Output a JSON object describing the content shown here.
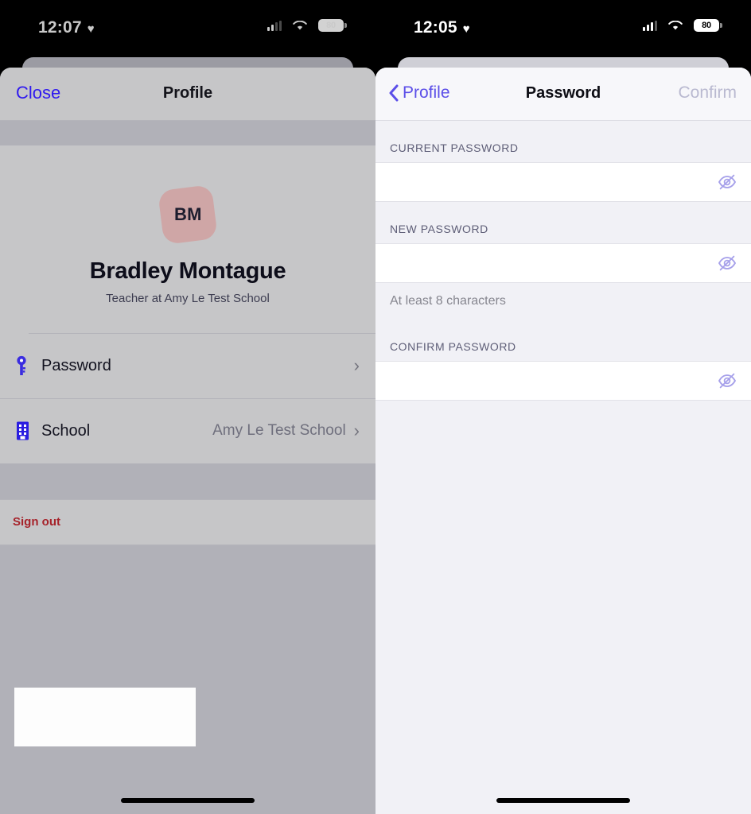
{
  "left": {
    "status": {
      "time": "12:07",
      "heart": "♥",
      "battery": "80",
      "signal_bars": 2,
      "signal_total": 4
    },
    "navbar": {
      "close_label": "Close",
      "title": "Profile"
    },
    "profile": {
      "avatar_initials": "BM",
      "avatar_color": "#cfa6a6",
      "name": "Bradley Montague",
      "role": "Teacher at Amy Le Test School"
    },
    "rows": [
      {
        "icon": "key-icon",
        "label": "Password",
        "value": "",
        "chevron": "›",
        "selected": true
      },
      {
        "icon": "building-icon",
        "label": "School",
        "value": "Amy Le Test School",
        "chevron": "›",
        "selected": false
      }
    ],
    "signout_label": "Sign out",
    "signout_color": "#a6232b"
  },
  "right": {
    "status": {
      "time": "12:05",
      "heart": "♥",
      "battery": "80",
      "signal_bars": 3,
      "signal_total": 4
    },
    "navbar": {
      "back_label": "Profile",
      "back_icon": "chevron-left-icon",
      "title": "Password",
      "confirm_label": "Confirm",
      "confirm_enabled": false
    },
    "sections": [
      {
        "header": "CURRENT PASSWORD",
        "value": "",
        "placeholder": "",
        "reveal_icon": "eye-slash-icon",
        "hint": ""
      },
      {
        "header": "NEW PASSWORD",
        "value": "",
        "placeholder": "",
        "reveal_icon": "eye-slash-icon",
        "hint": "At least 8 characters"
      },
      {
        "header": "CONFIRM PASSWORD",
        "value": "",
        "placeholder": "",
        "reveal_icon": "eye-slash-icon",
        "hint": ""
      }
    ]
  },
  "colors": {
    "accent_blue": "#2f19ef",
    "accent_indigo": "#5b4ee8",
    "eye_icon": "#a6a0ea",
    "destructive": "#a6232b"
  }
}
